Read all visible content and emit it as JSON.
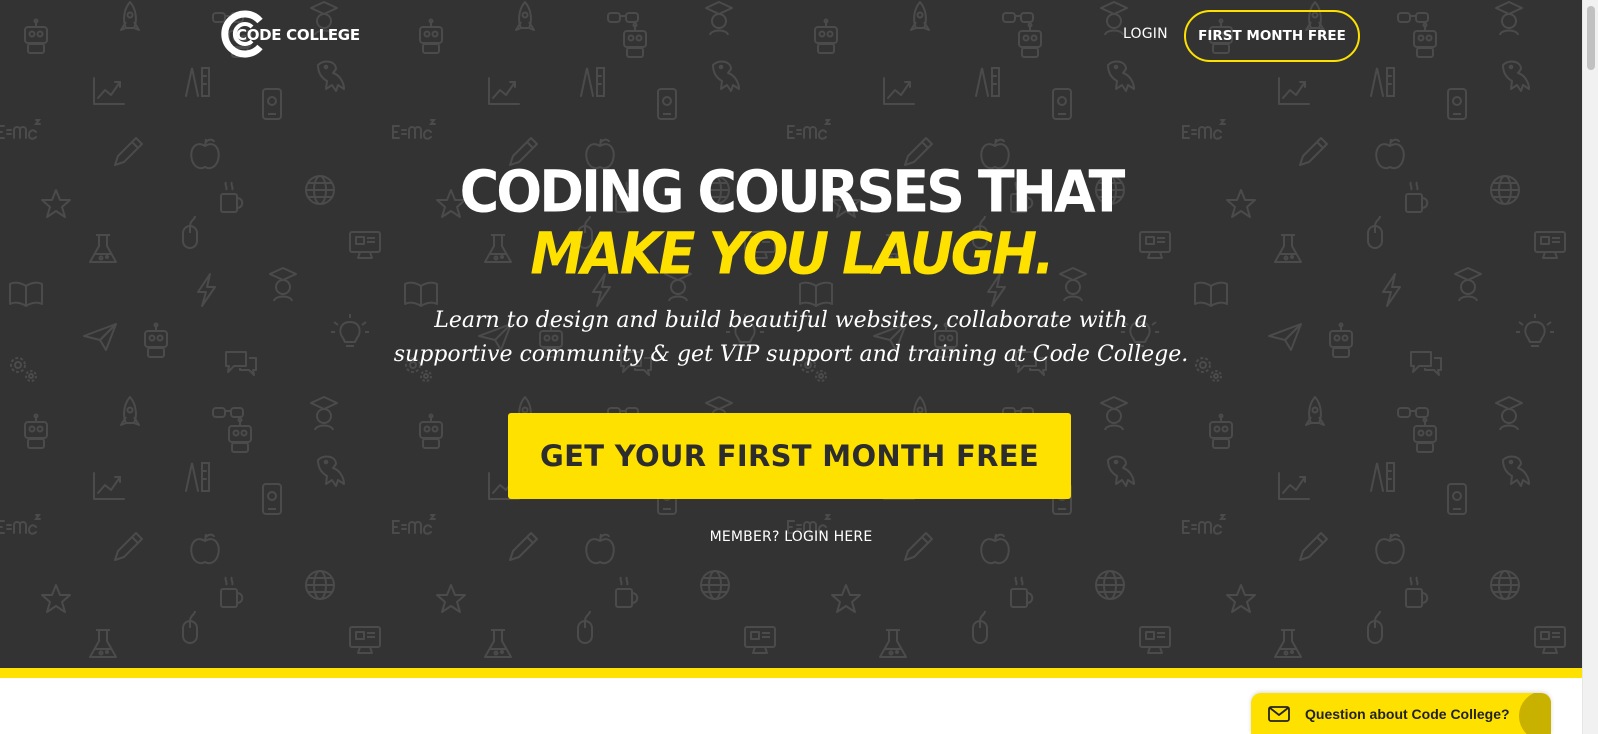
{
  "header": {
    "logo_text": "CODE COLLEGE",
    "login_label": "LOGIN",
    "cta_label": "FIRST MONTH FREE"
  },
  "hero": {
    "headline_line1": "CODING COURSES THAT",
    "headline_line2": "MAKE YOU LAUGH.",
    "subtitle": "Learn to design and build beautiful websites, collaborate with a supportive community & get VIP support and training at Code College.",
    "cta_label": "GET YOUR FIRST MONTH FREE",
    "member_login_label": "MEMBER? LOGIN HERE"
  },
  "chat": {
    "label": "Question about Code College?",
    "icon": "envelope-icon"
  },
  "background_icons": [
    "robot",
    "glasses",
    "rocket",
    "graduate",
    "chart",
    "ruler-compass",
    "dinosaur",
    "phone",
    "formula",
    "pencil",
    "apple",
    "star",
    "mug",
    "globe",
    "mouse",
    "flask",
    "monitor",
    "book",
    "lightning",
    "paper-plane",
    "gears",
    "lightbulb",
    "speech-bubble"
  ],
  "colors": {
    "hero_background": "#333333",
    "accent": "#ffe100",
    "text_light": "#ffffff",
    "cta_text": "#2d2d2d"
  }
}
